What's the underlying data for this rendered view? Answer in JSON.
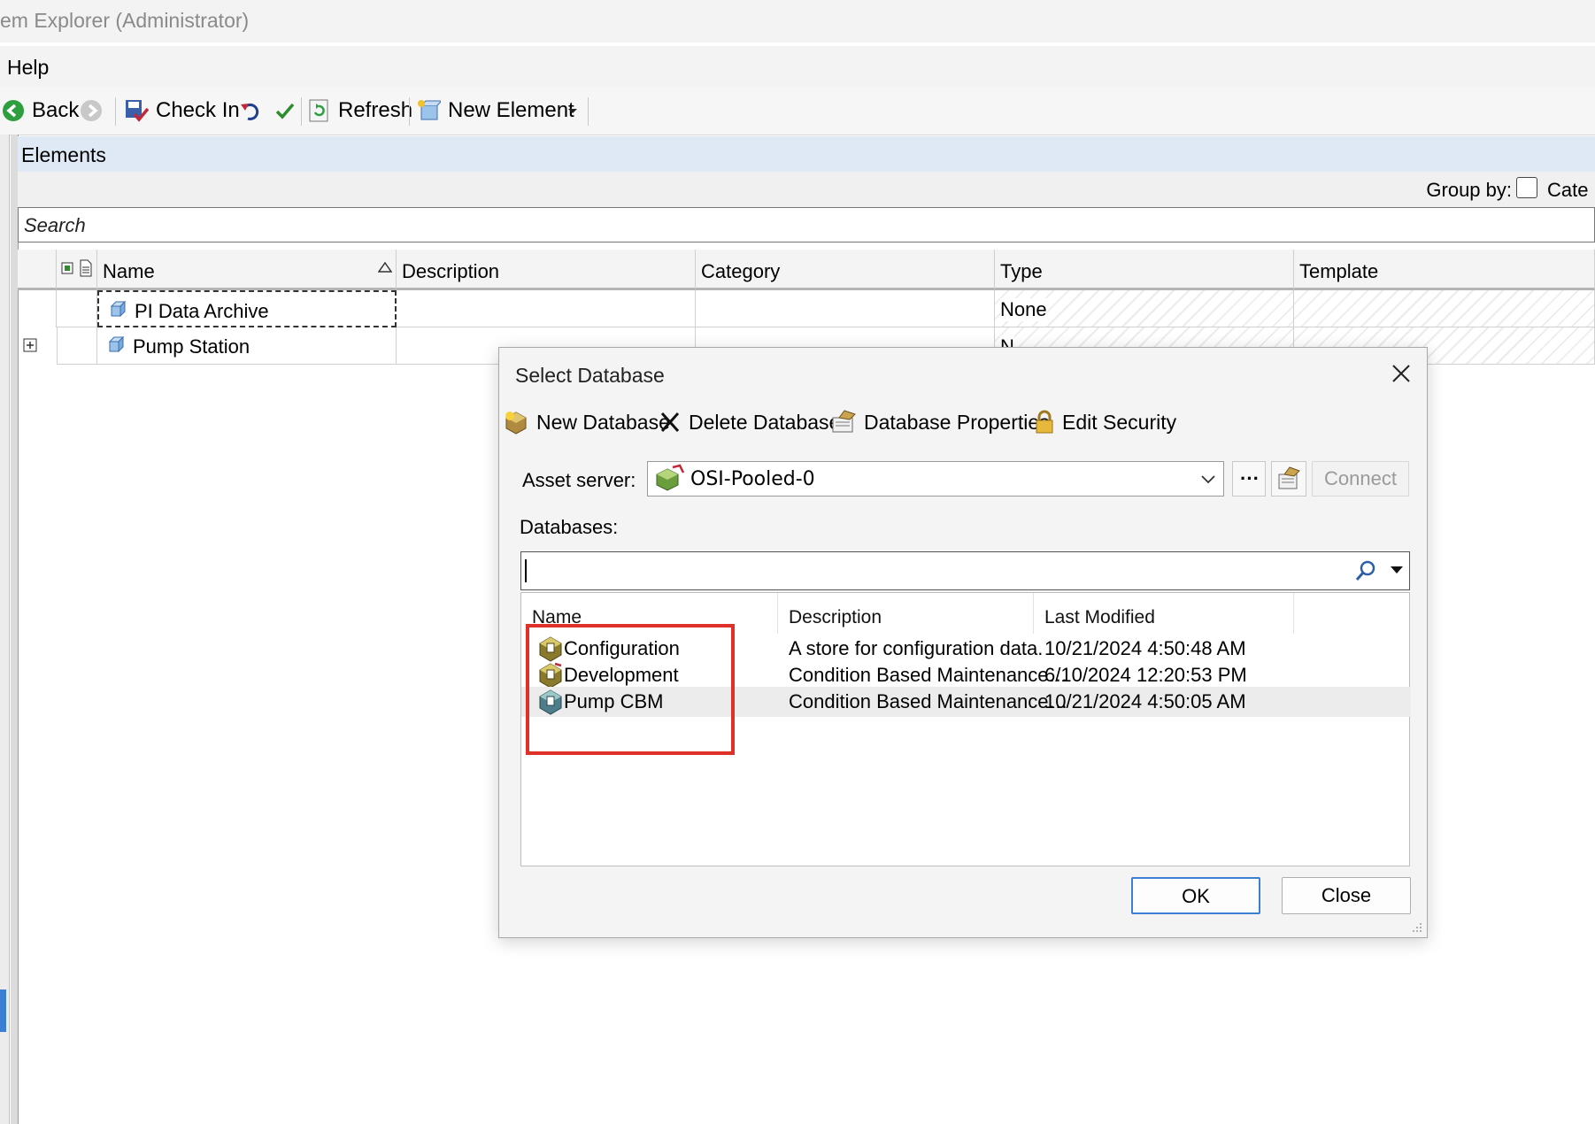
{
  "window": {
    "title": "em Explorer (Administrator)"
  },
  "menu": {
    "help": "Help"
  },
  "toolbar": {
    "back": "Back",
    "check_in": "Check In",
    "refresh": "Refresh",
    "new_element": "New Element"
  },
  "elements_panel": {
    "title": "Elements",
    "group_by_label": "Group by:",
    "group_by_option": "Cate",
    "search_placeholder": "Search",
    "columns": [
      "Name",
      "Description",
      "Category",
      "Type",
      "Template"
    ],
    "rows": [
      {
        "name": "PI Data Archive",
        "description": "",
        "category": "",
        "type": "None",
        "template": ""
      },
      {
        "name": "Pump Station",
        "description": "",
        "category": "",
        "type": "N",
        "template": ""
      }
    ]
  },
  "dialog": {
    "title": "Select Database",
    "tools": {
      "new_database": "New Database",
      "delete_database": "Delete Database",
      "database_properties": "Database Properties",
      "edit_security": "Edit Security"
    },
    "asset_server_label": "Asset server:",
    "asset_server_value": "OSI-Pooled-0",
    "more_button": "···",
    "connect_button": "Connect",
    "databases_label": "Databases:",
    "database_search_value": "",
    "list_columns": [
      "Name",
      "Description",
      "Last Modified"
    ],
    "databases": [
      {
        "name": "Configuration",
        "description": "A store for configuration data.",
        "last_modified": "10/21/2024 4:50:48 AM"
      },
      {
        "name": "Development",
        "description": "Condition Based Maintenance…",
        "last_modified": "6/10/2024 12:20:53 PM"
      },
      {
        "name": "Pump CBM",
        "description": "Condition Based Maintenance…",
        "last_modified": "10/21/2024 4:50:05 AM"
      }
    ],
    "ok_button": "OK",
    "close_button": "Close"
  },
  "colors": {
    "panel_header_bg": "#dfe9f6",
    "highlight_box": "#e0302a",
    "ok_border": "#3d7fd1"
  }
}
